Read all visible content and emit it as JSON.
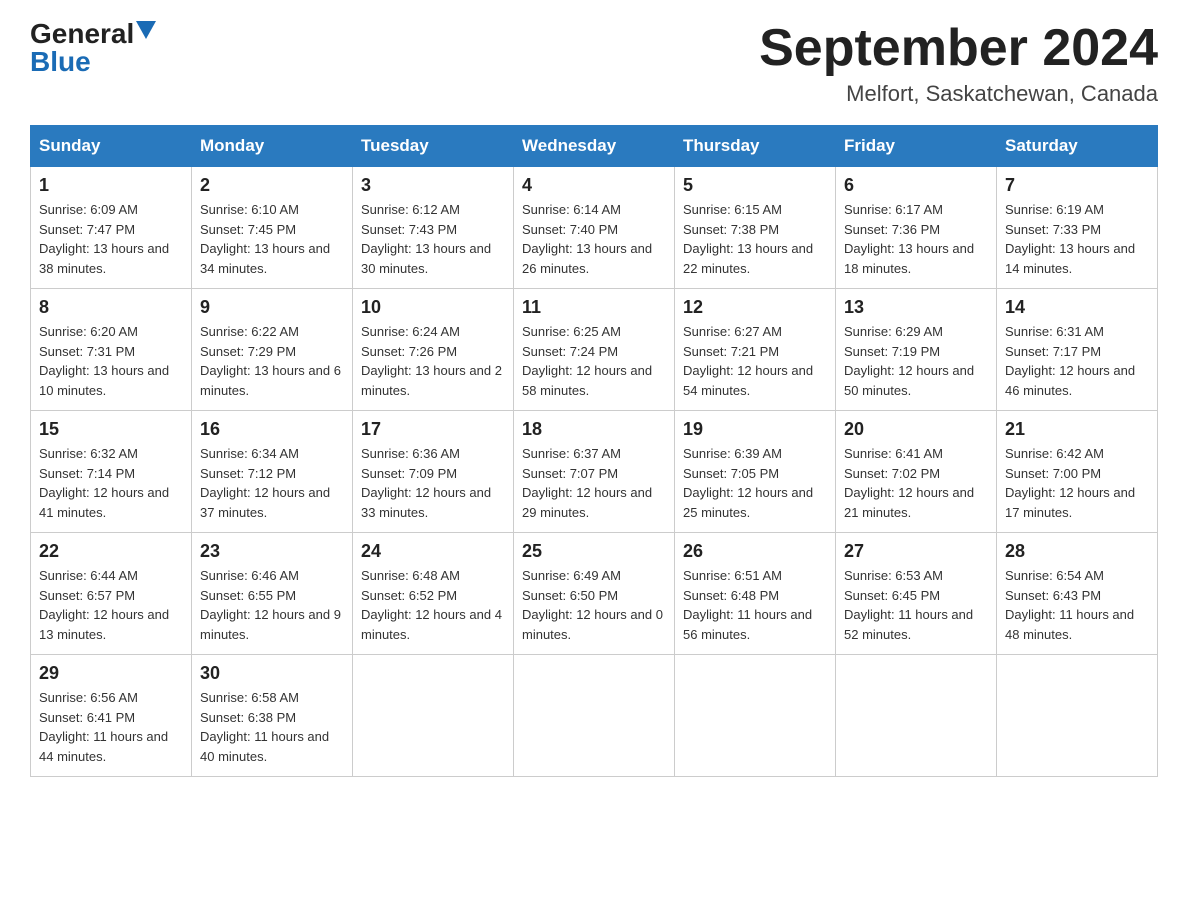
{
  "header": {
    "logo_general": "General",
    "logo_blue": "Blue",
    "title": "September 2024",
    "subtitle": "Melfort, Saskatchewan, Canada"
  },
  "columns": [
    "Sunday",
    "Monday",
    "Tuesday",
    "Wednesday",
    "Thursday",
    "Friday",
    "Saturday"
  ],
  "weeks": [
    [
      {
        "day": "1",
        "sunrise": "Sunrise: 6:09 AM",
        "sunset": "Sunset: 7:47 PM",
        "daylight": "Daylight: 13 hours and 38 minutes."
      },
      {
        "day": "2",
        "sunrise": "Sunrise: 6:10 AM",
        "sunset": "Sunset: 7:45 PM",
        "daylight": "Daylight: 13 hours and 34 minutes."
      },
      {
        "day": "3",
        "sunrise": "Sunrise: 6:12 AM",
        "sunset": "Sunset: 7:43 PM",
        "daylight": "Daylight: 13 hours and 30 minutes."
      },
      {
        "day": "4",
        "sunrise": "Sunrise: 6:14 AM",
        "sunset": "Sunset: 7:40 PM",
        "daylight": "Daylight: 13 hours and 26 minutes."
      },
      {
        "day": "5",
        "sunrise": "Sunrise: 6:15 AM",
        "sunset": "Sunset: 7:38 PM",
        "daylight": "Daylight: 13 hours and 22 minutes."
      },
      {
        "day": "6",
        "sunrise": "Sunrise: 6:17 AM",
        "sunset": "Sunset: 7:36 PM",
        "daylight": "Daylight: 13 hours and 18 minutes."
      },
      {
        "day": "7",
        "sunrise": "Sunrise: 6:19 AM",
        "sunset": "Sunset: 7:33 PM",
        "daylight": "Daylight: 13 hours and 14 minutes."
      }
    ],
    [
      {
        "day": "8",
        "sunrise": "Sunrise: 6:20 AM",
        "sunset": "Sunset: 7:31 PM",
        "daylight": "Daylight: 13 hours and 10 minutes."
      },
      {
        "day": "9",
        "sunrise": "Sunrise: 6:22 AM",
        "sunset": "Sunset: 7:29 PM",
        "daylight": "Daylight: 13 hours and 6 minutes."
      },
      {
        "day": "10",
        "sunrise": "Sunrise: 6:24 AM",
        "sunset": "Sunset: 7:26 PM",
        "daylight": "Daylight: 13 hours and 2 minutes."
      },
      {
        "day": "11",
        "sunrise": "Sunrise: 6:25 AM",
        "sunset": "Sunset: 7:24 PM",
        "daylight": "Daylight: 12 hours and 58 minutes."
      },
      {
        "day": "12",
        "sunrise": "Sunrise: 6:27 AM",
        "sunset": "Sunset: 7:21 PM",
        "daylight": "Daylight: 12 hours and 54 minutes."
      },
      {
        "day": "13",
        "sunrise": "Sunrise: 6:29 AM",
        "sunset": "Sunset: 7:19 PM",
        "daylight": "Daylight: 12 hours and 50 minutes."
      },
      {
        "day": "14",
        "sunrise": "Sunrise: 6:31 AM",
        "sunset": "Sunset: 7:17 PM",
        "daylight": "Daylight: 12 hours and 46 minutes."
      }
    ],
    [
      {
        "day": "15",
        "sunrise": "Sunrise: 6:32 AM",
        "sunset": "Sunset: 7:14 PM",
        "daylight": "Daylight: 12 hours and 41 minutes."
      },
      {
        "day": "16",
        "sunrise": "Sunrise: 6:34 AM",
        "sunset": "Sunset: 7:12 PM",
        "daylight": "Daylight: 12 hours and 37 minutes."
      },
      {
        "day": "17",
        "sunrise": "Sunrise: 6:36 AM",
        "sunset": "Sunset: 7:09 PM",
        "daylight": "Daylight: 12 hours and 33 minutes."
      },
      {
        "day": "18",
        "sunrise": "Sunrise: 6:37 AM",
        "sunset": "Sunset: 7:07 PM",
        "daylight": "Daylight: 12 hours and 29 minutes."
      },
      {
        "day": "19",
        "sunrise": "Sunrise: 6:39 AM",
        "sunset": "Sunset: 7:05 PM",
        "daylight": "Daylight: 12 hours and 25 minutes."
      },
      {
        "day": "20",
        "sunrise": "Sunrise: 6:41 AM",
        "sunset": "Sunset: 7:02 PM",
        "daylight": "Daylight: 12 hours and 21 minutes."
      },
      {
        "day": "21",
        "sunrise": "Sunrise: 6:42 AM",
        "sunset": "Sunset: 7:00 PM",
        "daylight": "Daylight: 12 hours and 17 minutes."
      }
    ],
    [
      {
        "day": "22",
        "sunrise": "Sunrise: 6:44 AM",
        "sunset": "Sunset: 6:57 PM",
        "daylight": "Daylight: 12 hours and 13 minutes."
      },
      {
        "day": "23",
        "sunrise": "Sunrise: 6:46 AM",
        "sunset": "Sunset: 6:55 PM",
        "daylight": "Daylight: 12 hours and 9 minutes."
      },
      {
        "day": "24",
        "sunrise": "Sunrise: 6:48 AM",
        "sunset": "Sunset: 6:52 PM",
        "daylight": "Daylight: 12 hours and 4 minutes."
      },
      {
        "day": "25",
        "sunrise": "Sunrise: 6:49 AM",
        "sunset": "Sunset: 6:50 PM",
        "daylight": "Daylight: 12 hours and 0 minutes."
      },
      {
        "day": "26",
        "sunrise": "Sunrise: 6:51 AM",
        "sunset": "Sunset: 6:48 PM",
        "daylight": "Daylight: 11 hours and 56 minutes."
      },
      {
        "day": "27",
        "sunrise": "Sunrise: 6:53 AM",
        "sunset": "Sunset: 6:45 PM",
        "daylight": "Daylight: 11 hours and 52 minutes."
      },
      {
        "day": "28",
        "sunrise": "Sunrise: 6:54 AM",
        "sunset": "Sunset: 6:43 PM",
        "daylight": "Daylight: 11 hours and 48 minutes."
      }
    ],
    [
      {
        "day": "29",
        "sunrise": "Sunrise: 6:56 AM",
        "sunset": "Sunset: 6:41 PM",
        "daylight": "Daylight: 11 hours and 44 minutes."
      },
      {
        "day": "30",
        "sunrise": "Sunrise: 6:58 AM",
        "sunset": "Sunset: 6:38 PM",
        "daylight": "Daylight: 11 hours and 40 minutes."
      },
      null,
      null,
      null,
      null,
      null
    ]
  ]
}
